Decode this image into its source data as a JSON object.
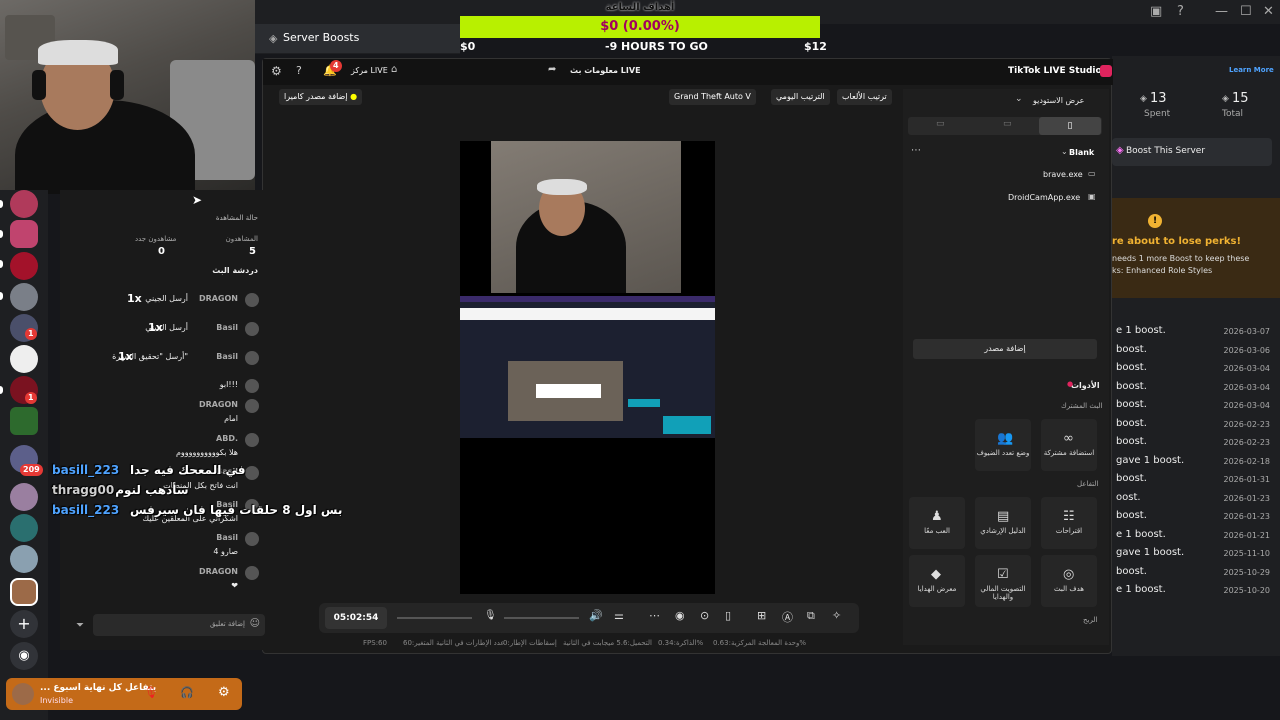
{
  "server_header": {
    "title": "Server Boosts"
  },
  "goal": {
    "title": "أهداف الساعة",
    "amount": "$0 (0.00%)",
    "start": "$0",
    "time_left": "-9 HOURS TO GO",
    "end": "$12"
  },
  "boosts": {
    "spent_value": "13",
    "spent_label": "Spent",
    "total_value": "15",
    "total_label": "Total",
    "learn_more": "Learn More",
    "boost_server": "Boost This Server",
    "warning_title": "re about to lose perks!",
    "warning_text_1": "needs 1 more Boost to keep these",
    "warning_text_2": "ks: Enhanced Role Styles",
    "history": [
      {
        "text": "e 1 boost.",
        "date": "2026-03-07"
      },
      {
        "text": "boost.",
        "date": "2026-03-06"
      },
      {
        "text": "boost.",
        "date": "2026-03-04"
      },
      {
        "text": "boost.",
        "date": "2026-03-04"
      },
      {
        "text": "boost.",
        "date": "2026-03-04"
      },
      {
        "text": "boost.",
        "date": "2026-02-23"
      },
      {
        "text": "boost.",
        "date": "2026-02-23"
      },
      {
        "text": "gave 1 boost.",
        "date": "2026-02-18"
      },
      {
        "text": "boost.",
        "date": "2026-01-31"
      },
      {
        "text": "oost.",
        "date": "2026-01-23"
      },
      {
        "text": "boost.",
        "date": "2026-01-23"
      },
      {
        "text": "e 1 boost.",
        "date": "2026-01-21"
      },
      {
        "text": "gave 1 boost.",
        "date": "2025-11-10"
      },
      {
        "text": "boost.",
        "date": "2025-10-29"
      },
      {
        "text": "e 1 boost.",
        "date": "2025-10-20"
      }
    ]
  },
  "studio": {
    "app_title": "TikTok LIVE Studio",
    "live_info": "معلومات بث LIVE",
    "live_center": "مركز LIVE",
    "notif_count": "4",
    "add_camera": "إضافة مصدر كاميرا",
    "chips": [
      "Grand Theft Auto V",
      "الترتيب اليومي",
      "ترتيب الألعاب"
    ],
    "studio_view": "عرض الاستوديو",
    "scene_name": "Blank",
    "sources": [
      "brave.exe",
      "DroidCamApp.exe"
    ],
    "add_source": "إضافة مصدر",
    "tools_title": "الأدوات",
    "section_shared": "البث المشترك",
    "section_interact": "التفاعل",
    "section_profit": "الربح",
    "tools": [
      {
        "label": "استضافة مشتركة",
        "icon": "link-icon"
      },
      {
        "label": "وضع تعدد الضيوف",
        "icon": "users-icon"
      },
      {
        "label": "اقتراحات",
        "icon": "chat-icon"
      },
      {
        "label": "الدليل الإرشادي",
        "icon": "book-icon"
      },
      {
        "label": "العب معًا",
        "icon": "game-icon"
      },
      {
        "label": "هدف البث",
        "icon": "target-icon"
      },
      {
        "label": "التصويت المالي والهدايا",
        "icon": "vote-icon"
      },
      {
        "label": "معرض الهدايا",
        "icon": "gift-icon"
      }
    ],
    "timer": "05:02:54",
    "stats": [
      "وحدة المعالجة المركزية:0.63%",
      "الذاكرة:0.34%",
      "التحميل:5.6 ميجابت في الثانية",
      "إسقاطات الإطار:0",
      "عدد الإطارات في الثانية المتغير:60",
      "FPS:60"
    ],
    "view_state": "حالة المشاهدة",
    "viewers_label": "المشاهدون",
    "viewers_value": "5",
    "new_viewers_label": "مشاهدون جدد",
    "new_viewers_value": "0",
    "chat_title": "دردشة البث",
    "comment_placeholder": "إضافة تعليق"
  },
  "chat": [
    {
      "user": "DRAGON",
      "text": "أرسل الجيني",
      "count": "1x"
    },
    {
      "user": "Basil",
      "text": "أرسل الجيني",
      "count": "1x"
    },
    {
      "user": "Basil",
      "text": "أرسل \"تحقيق الشهرة\"",
      "count": "1x"
    },
    {
      "user": "",
      "text": "ابو!!!"
    },
    {
      "user": "DRAGON",
      "text": "امام"
    },
    {
      "user": "ABD.",
      "text": "هلا بكووووووووووم"
    },
    {
      "user": "Basil",
      "text": "انت فاتح بكل المنصات"
    },
    {
      "user": "Basil",
      "text": "اشكراني على المعلقين عليك"
    },
    {
      "user": "Basil",
      "text": "صارو 4"
    },
    {
      "user": "DRAGON",
      "text": "❤"
    }
  ],
  "overlay_chat": [
    {
      "user": "basill_223",
      "text": "في المعحك فيه جدا",
      "color": "#4fa3ff"
    },
    {
      "user": "thragg00",
      "text": "سأذهب لنوم",
      "color": "#cfcfcf"
    },
    {
      "user": "basill_223",
      "text": "بس اول 8 حلقات فيها فان سيرفس",
      "color": "#4fa3ff"
    }
  ],
  "guild_badges": [
    "1",
    "1",
    "209"
  ],
  "user_panel": {
    "name": "... يتفاعل كل نهاية اسبوع",
    "status": "Invisible"
  }
}
